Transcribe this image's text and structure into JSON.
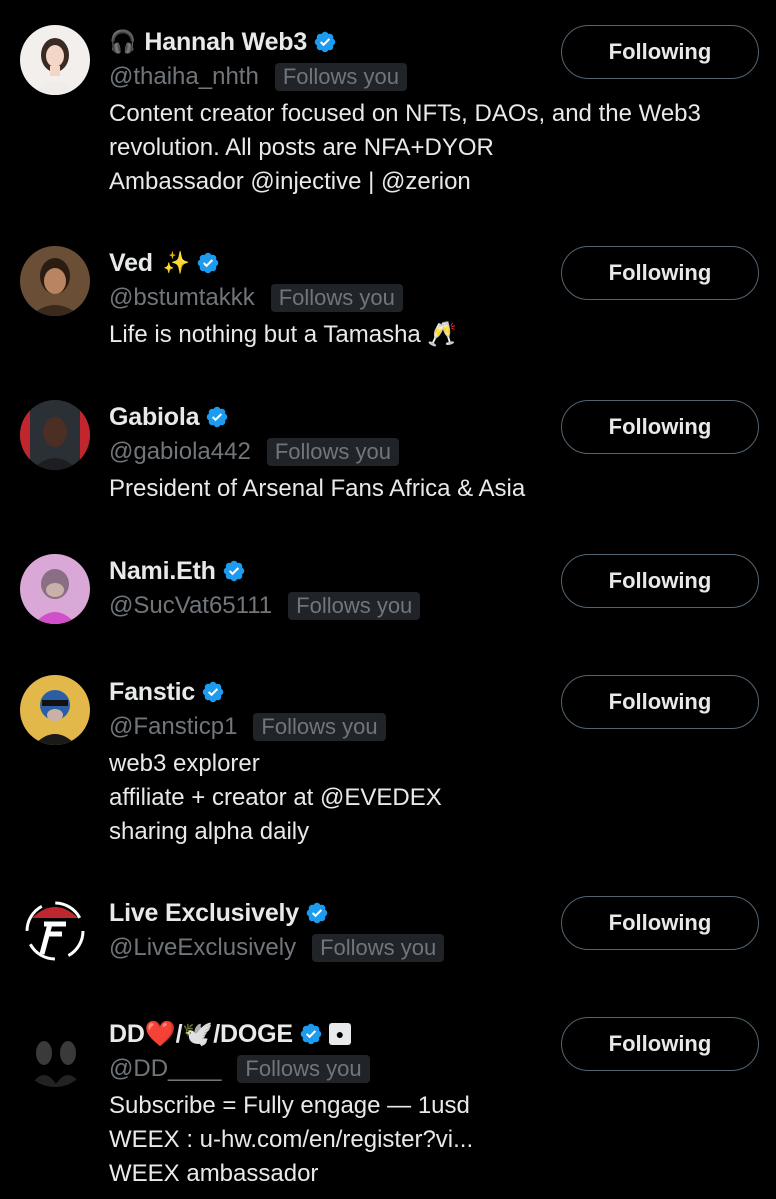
{
  "follow_button_label": "Following",
  "follows_you_label": "Follows you",
  "colors": {
    "background": "#000000",
    "text": "#e7e9ea",
    "secondary": "#71767b",
    "verified": "#1d9bf0",
    "pill_bg": "#202327",
    "button_border": "#536471"
  },
  "users": [
    {
      "name": "Hannah Web3",
      "prefix_emoji": "🎧",
      "suffix_emoji": "",
      "handle": "@thaiha_nhth",
      "verified": true,
      "follows_you": true,
      "bio": [
        "Content creator focused on NFTs, DAOs, and the Web3",
        "revolution. All posts are NFA+DYOR",
        "Ambassador @injective | @zerion"
      ],
      "avatar_icon": "woman-portrait-icon"
    },
    {
      "name": "Ved",
      "prefix_emoji": "",
      "suffix_emoji": "✨",
      "handle": "@bstumtakkk",
      "verified": true,
      "follows_you": true,
      "bio": [
        "Life is nothing but a Tamasha 🥂"
      ],
      "avatar_icon": "man-portrait-icon"
    },
    {
      "name": "Gabiola",
      "prefix_emoji": "",
      "suffix_emoji": "",
      "handle": "@gabiola442",
      "verified": true,
      "follows_you": true,
      "bio": [
        "President of Arsenal Fans Africa & Asia"
      ],
      "avatar_icon": "man-portrait-icon"
    },
    {
      "name": "Nami.Eth",
      "prefix_emoji": "",
      "suffix_emoji": "",
      "handle": "@SucVat65111",
      "verified": true,
      "follows_you": true,
      "bio": [],
      "avatar_icon": "ape-nft-icon"
    },
    {
      "name": "Fanstic",
      "prefix_emoji": "",
      "suffix_emoji": "",
      "handle": "@Fansticp1",
      "verified": true,
      "follows_you": true,
      "bio": [
        "web3 explorer",
        "affiliate + creator at @EVEDEX",
        "sharing alpha daily"
      ],
      "avatar_icon": "ape-nft-icon"
    },
    {
      "name": "Live Exclusively",
      "prefix_emoji": "",
      "suffix_emoji": "",
      "handle": "@LiveExclusively",
      "verified": true,
      "follows_you": true,
      "bio": [],
      "avatar_icon": "brand-logo-icon"
    },
    {
      "name": "DD❤️/🕊️/DOGE",
      "prefix_emoji": "",
      "suffix_emoji": "",
      "handle": "@DD____",
      "verified": true,
      "follows_you": true,
      "bio": [
        "Subscribe = Fully engage — 1usd",
        "WEEX : u-hw.com/en/register?vi...",
        "WEEX ambassador"
      ],
      "avatar_icon": "people-photo-icon"
    }
  ]
}
